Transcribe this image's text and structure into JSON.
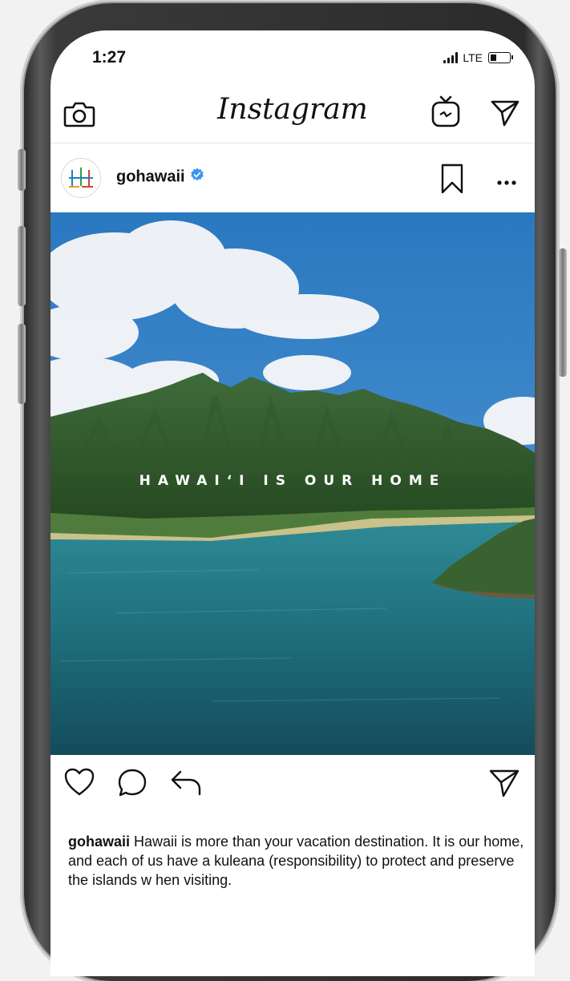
{
  "status_bar": {
    "time": "1:27",
    "network": "LTE"
  },
  "app": {
    "name": "Instagram"
  },
  "post": {
    "username": "gohawaii",
    "image_overlay_text": "HAWAIʻI IS OUR HOME",
    "caption_text": "Hawaii is more than your vacation destination. It is our home, and each of us have a kuleana (responsibility) to protect and preserve the islands w hen visiting."
  },
  "icons": {
    "camera": "camera-icon",
    "igtv": "igtv-icon",
    "direct": "direct-message-icon",
    "save": "bookmark-icon",
    "more": "more-options-icon",
    "like": "heart-icon",
    "comment": "comment-icon",
    "share": "share-icon",
    "verified": "verified-badge-icon"
  },
  "colors": {
    "verified": "#3897f0",
    "sky": "#2f7fc4",
    "water": "#1e6a78",
    "frame": "#2b2b2b"
  }
}
